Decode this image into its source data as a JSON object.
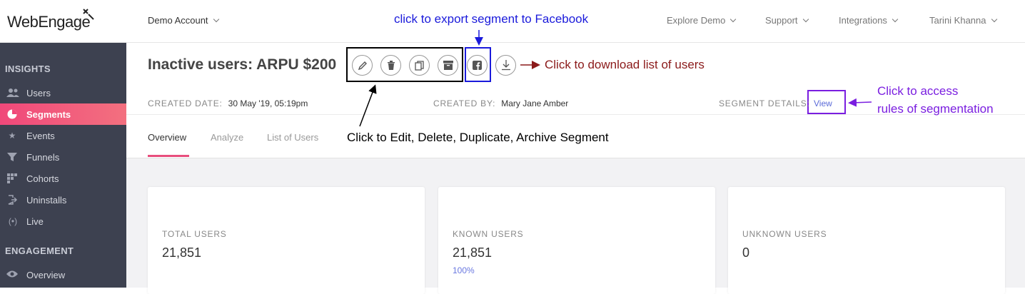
{
  "brand": {
    "logo_text": "WebEngage"
  },
  "header": {
    "account": "Demo Account",
    "nav": [
      "Explore Demo",
      "Support",
      "Integrations",
      "Tarini Khanna"
    ]
  },
  "sidebar": {
    "sections": [
      {
        "title": "INSIGHTS",
        "items": [
          {
            "label": "Users",
            "icon": "users-icon"
          },
          {
            "label": "Segments",
            "icon": "pie-icon",
            "active": true
          },
          {
            "label": "Events",
            "icon": "star-icon"
          },
          {
            "label": "Funnels",
            "icon": "funnel-icon"
          },
          {
            "label": "Cohorts",
            "icon": "grid-icon"
          },
          {
            "label": "Uninstalls",
            "icon": "exit-icon"
          },
          {
            "label": "Live",
            "icon": "broadcast-icon"
          }
        ]
      },
      {
        "title": "ENGAGEMENT",
        "items": [
          {
            "label": "Overview",
            "icon": "eye-icon"
          }
        ]
      }
    ]
  },
  "segment": {
    "title": "Inactive users: ARPU $200",
    "created_date_label": "CREATED DATE:",
    "created_date": "30 May '19, 05:19pm",
    "created_by_label": "CREATED BY:",
    "created_by": "Mary Jane Amber",
    "details_label": "SEGMENT DETAILS:",
    "details_link": "View"
  },
  "tabs": [
    {
      "label": "Overview",
      "active": true
    },
    {
      "label": "Analyze"
    },
    {
      "label": "List of Users"
    }
  ],
  "stats": [
    {
      "label": "TOTAL USERS",
      "value": "21,851"
    },
    {
      "label": "KNOWN USERS",
      "value": "21,851",
      "percent": "100%"
    },
    {
      "label": "UNKNOWN USERS",
      "value": "0"
    }
  ],
  "annotations": {
    "export_fb": "click to export segment to Facebook",
    "download": "Click to download list of users",
    "edit_actions": "Click to Edit, Delete, Duplicate, Archive Segment",
    "rules": [
      "Click to access",
      "rules of segmentation"
    ]
  },
  "colors": {
    "accent": "#e84e7d",
    "sidebar_bg": "#3d4150",
    "annotation_blue": "#1a1adb",
    "annotation_red": "#8b1a1a",
    "annotation_purple": "#7a1ee0"
  }
}
